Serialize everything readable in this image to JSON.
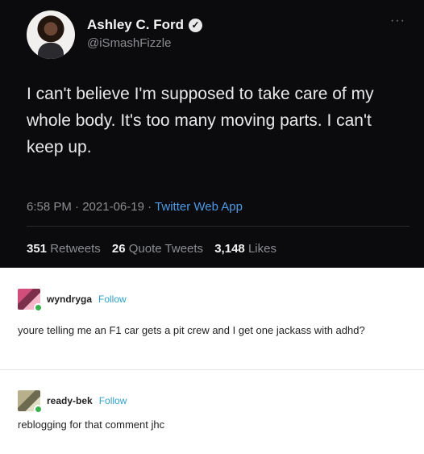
{
  "tweet": {
    "display_name": "Ashley C. Ford",
    "verified_glyph": "✓",
    "handle": "@iSmashFizzle",
    "more_glyph": "···",
    "text": "I can't believe I'm supposed to take care of my whole body. It's too many moving parts. I can't keep up.",
    "time": "6:58 PM",
    "date": "2021-06-19",
    "separator": "·",
    "app": "Twitter Web App",
    "retweets_count": "351",
    "retweets_label": "Retweets",
    "quotes_count": "26",
    "quotes_label": "Quote Tweets",
    "likes_count": "3,148",
    "likes_label": "Likes",
    "icons": [
      "verified-icon",
      "more-icon"
    ]
  },
  "comments": [
    {
      "username": "wyndryga",
      "follow_label": "Follow",
      "text": "youre telling me an F1 car gets a pit crew and I get one jackass with adhd?"
    },
    {
      "username": "ready-bek",
      "follow_label": "Follow",
      "text": "reblogging for that comment jhc"
    }
  ],
  "colors": {
    "tweet_bg": "#0b0b0d",
    "link_blue": "#4d9be6",
    "follow_blue": "#2ea0c6",
    "online_green": "#37b24d"
  }
}
